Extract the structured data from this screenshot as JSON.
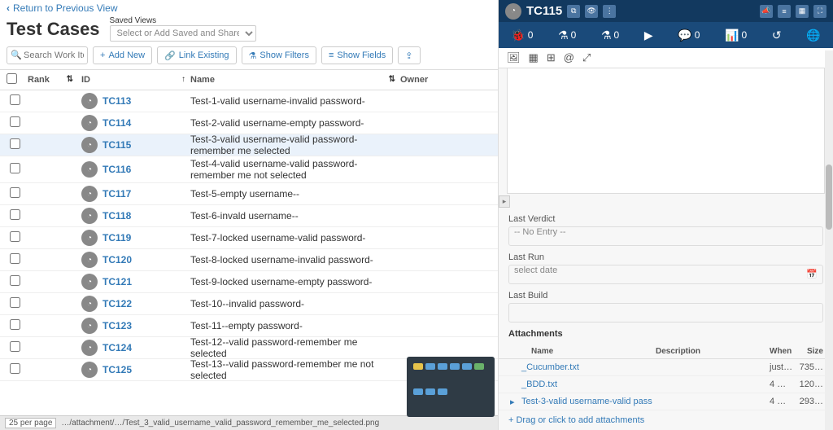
{
  "breadcrumb": {
    "back_label": "Return to Previous View"
  },
  "page": {
    "title": "Test Cases"
  },
  "saved_views": {
    "label": "Saved Views",
    "placeholder": "Select or Add Saved and Shared Views"
  },
  "search": {
    "placeholder": "Search Work Items"
  },
  "toolbar": {
    "add_new": "Add New",
    "link_existing": "Link Existing",
    "show_filters": "Show Filters",
    "show_fields": "Show Fields"
  },
  "columns": {
    "rank": "Rank",
    "id": "ID",
    "name": "Name",
    "owner": "Owner"
  },
  "rows": [
    {
      "id": "TC113",
      "name": "Test-1-valid username-invalid password-",
      "selected": false
    },
    {
      "id": "TC114",
      "name": "Test-2-valid username-empty password-",
      "selected": false
    },
    {
      "id": "TC115",
      "name": "Test-3-valid username-valid password-remember me selected",
      "selected": true
    },
    {
      "id": "TC116",
      "name": "Test-4-valid username-valid password-remember me not selected",
      "selected": false,
      "tall": true
    },
    {
      "id": "TC117",
      "name": "Test-5-empty username--",
      "selected": false
    },
    {
      "id": "TC118",
      "name": "Test-6-invald username--",
      "selected": false
    },
    {
      "id": "TC119",
      "name": "Test-7-locked username-valid password-",
      "selected": false
    },
    {
      "id": "TC120",
      "name": "Test-8-locked username-invalid password-",
      "selected": false
    },
    {
      "id": "TC121",
      "name": "Test-9-locked username-empty password-",
      "selected": false
    },
    {
      "id": "TC122",
      "name": "Test-10--invalid password-",
      "selected": false
    },
    {
      "id": "TC123",
      "name": "Test-11--empty password-",
      "selected": false
    },
    {
      "id": "TC124",
      "name": "Test-12--valid password-remember me selected",
      "selected": false
    },
    {
      "id": "TC125",
      "name": "Test-13--valid password-remember me not selected",
      "selected": false
    }
  ],
  "footer": {
    "per_page_label": "25 per page",
    "status_partial": "…/attachment/…/Test_3_valid_username_valid_password_remember_me_selected.png"
  },
  "detail": {
    "title": "TC115",
    "nav_counts": {
      "bug": "0",
      "flask1": "0",
      "flask2": "0",
      "chat": "0",
      "chart": "0"
    },
    "last_verdict": {
      "label": "Last Verdict",
      "value": "-- No Entry --"
    },
    "last_run": {
      "label": "Last Run",
      "placeholder": "select date"
    },
    "last_build": {
      "label": "Last Build",
      "value": ""
    },
    "attachments": {
      "title": "Attachments",
      "columns": {
        "name": "Name",
        "desc": "Description",
        "when": "When",
        "size": "Size"
      },
      "items": [
        {
          "name": "_Cucumber.txt",
          "desc": "",
          "when": "just…",
          "size": "735…"
        },
        {
          "name": "_BDD.txt",
          "desc": "",
          "when": "4 …",
          "size": "120…"
        },
        {
          "name": "Test-3-valid username-valid pass",
          "desc": "",
          "when": "4 …",
          "size": "293…",
          "expand": true
        }
      ],
      "drop": "Drag or click to add attachments"
    }
  }
}
